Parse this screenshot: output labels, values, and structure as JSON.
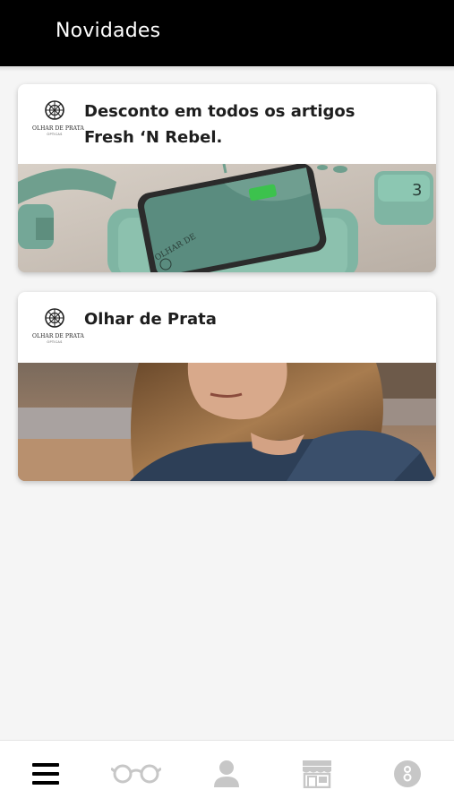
{
  "header": {
    "title": "Novidades"
  },
  "posts": [
    {
      "title": "Desconto em todos os artigos Fresh ‘N Rebel.",
      "logo": {
        "name": "OLHAR DE PRATA",
        "sub": "ÓPTICAS"
      }
    },
    {
      "title": "Olhar de Prata",
      "logo": {
        "name": "OLHAR DE PRATA",
        "sub": "ÓPTICAS"
      }
    }
  ],
  "image1": {
    "watermark": "OLHAR DE"
  },
  "bottom_nav": {
    "items": [
      {
        "icon": "menu-icon"
      },
      {
        "icon": "glasses-icon"
      },
      {
        "icon": "user-icon"
      },
      {
        "icon": "store-icon"
      },
      {
        "icon": "info-icon"
      }
    ]
  },
  "colors": {
    "header": "#000000",
    "background": "#f5f5f5",
    "active_icon": "#000000",
    "inactive_icon": "#c7c7c7"
  }
}
